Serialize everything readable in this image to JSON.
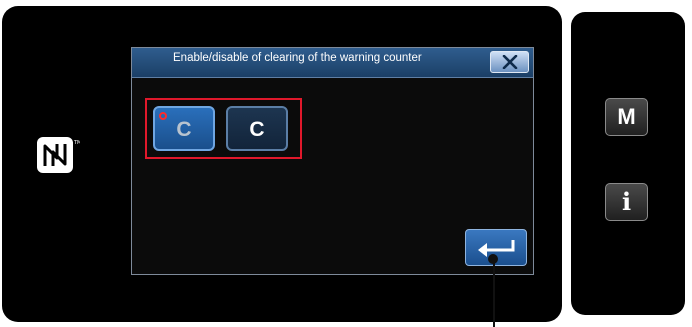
{
  "dialog": {
    "title": "Enable/disable of clearing of the warning counter"
  },
  "buttons": {
    "clear_enabled_label": "C",
    "clear_disabled_label": "C",
    "menu_label": "M",
    "info_label": "i"
  },
  "colors": {
    "panel": "#000000",
    "titlebar": "#2f5d8e",
    "highlight": "#e0182b",
    "button_active": "#2a6fbb"
  },
  "icons": [
    "nfc-icon",
    "close-icon",
    "enter-icon",
    "active-indicator-icon"
  ]
}
